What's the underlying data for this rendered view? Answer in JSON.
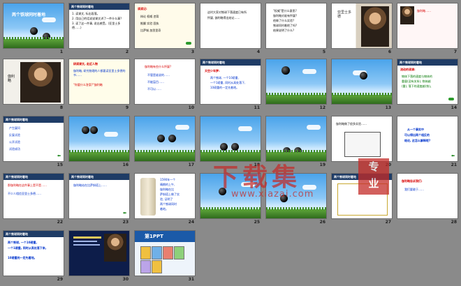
{
  "view": {
    "name": "slide sorter"
  },
  "slides": [
    {
      "n": "1",
      "title": "两个铁球同时着地"
    },
    {
      "n": "2",
      "bar": "两个铁球同时着地",
      "lines": [
        "1. 读课文, 标出段落。",
        "2. 用自己的话说说课文讲了一件什么事?",
        "3. 读了这一件事, 说出感受。(亚里士多德……)"
      ]
    },
    {
      "n": "3",
      "head": "读读记:",
      "lines": [
        "辩论  权威  违背",
        "推翻  实验  固执",
        "比萨城  加思里奇"
      ]
    },
    {
      "n": "4",
      "lines": [
        "这时大家对铁球下落速度已有所",
        "怀疑, 伽利略得出结论……"
      ]
    },
    {
      "n": "5",
      "lines": [
        "\"权威\"是什么意思?",
        "伽利略对谁有怀疑?",
        "他做了什么实验?",
        "铁球同时着地了吗?",
        "结果说明了什么?"
      ]
    },
    {
      "n": "6",
      "caption": "亚里士多德"
    },
    {
      "n": "7",
      "lines": [
        "伽利略……"
      ]
    },
    {
      "n": "8",
      "caption": "伽利略"
    },
    {
      "n": "9",
      "head": "研读课文, 走近人物",
      "lines": [
        "伽利略, 研究物理的人都要读亚里士多德的书……",
        "\"你要什么答案?\"伽利略"
      ]
    },
    {
      "n": "10",
      "head": "伽利略有些什么怀疑?",
      "lines": [
        "不管是谁说的……",
        "不能盲目……",
        "不可以……"
      ]
    },
    {
      "n": "11",
      "bar": "两个铁球同时着地",
      "head": "天空少年梦:",
      "lines": [
        "两个铁球, 一个10磅重,",
        "一个1磅重, 同时从高处落下,",
        "10磅重的一定先着地。"
      ]
    },
    {
      "n": "12"
    },
    {
      "n": "13"
    },
    {
      "n": "14",
      "bar": "两个铁球同时着地",
      "head": "流动的读课:",
      "lines": [
        "物体下落的速度与物体的",
        "重量(没有关系), 物体越",
        "(重), 落下的速度越(快)。"
      ]
    },
    {
      "n": "15",
      "bar": "两个铁球同时着地",
      "lines": [
        "产生疑问",
        "反复试验",
        "公开试验",
        "试验成功"
      ]
    },
    {
      "n": "16"
    },
    {
      "n": "17"
    },
    {
      "n": "18"
    },
    {
      "n": "19"
    },
    {
      "n": "20",
      "lines": [
        "伽利略做了很多实验……"
      ]
    },
    {
      "n": "21",
      "lines": [
        "从一个事实中",
        "可以得出两个相反的",
        "结论, 这怎么解释呢?"
      ]
    },
    {
      "n": "22",
      "bar": "两个铁球同时着地",
      "lines": [
        "那伽利略在这件事上是不是……",
        "不少人相信亚里士多德……"
      ]
    },
    {
      "n": "23",
      "bar": "两个铁球同时着地",
      "lines": [
        "伽利略站在比萨斜塔上……"
      ]
    },
    {
      "n": "24",
      "lines": [
        "1590年一个",
        "晴朗的上午,",
        "伽利略在比",
        "萨斜塔上做了实",
        "验, 证明了",
        "两个铁球同时",
        "着地。"
      ]
    },
    {
      "n": "25"
    },
    {
      "n": "26"
    },
    {
      "n": "27",
      "bar": "两个铁球同时着地"
    },
    {
      "n": "28",
      "head": "伽利略告诉我们:",
      "lines": [
        "我们要敢于……"
      ]
    },
    {
      "n": "29",
      "bar": "两个铁球同时着地",
      "lines": [
        "两个铁球, 一个10磅重,",
        "一个1磅重, 同时从高处落下来,",
        "10磅重的一定先着地。"
      ]
    },
    {
      "n": "30"
    },
    {
      "n": "31",
      "title": "第1PPT"
    }
  ],
  "watermark": {
    "brand": "下载集",
    "badge_top": "专",
    "badge_bottom": "业",
    "url": "www.xiazai.com"
  },
  "colors": {
    "accent": "#c42b28",
    "bar": "#1f3c66",
    "grass": "#5ea53a",
    "sky": "#4aa3ea"
  }
}
